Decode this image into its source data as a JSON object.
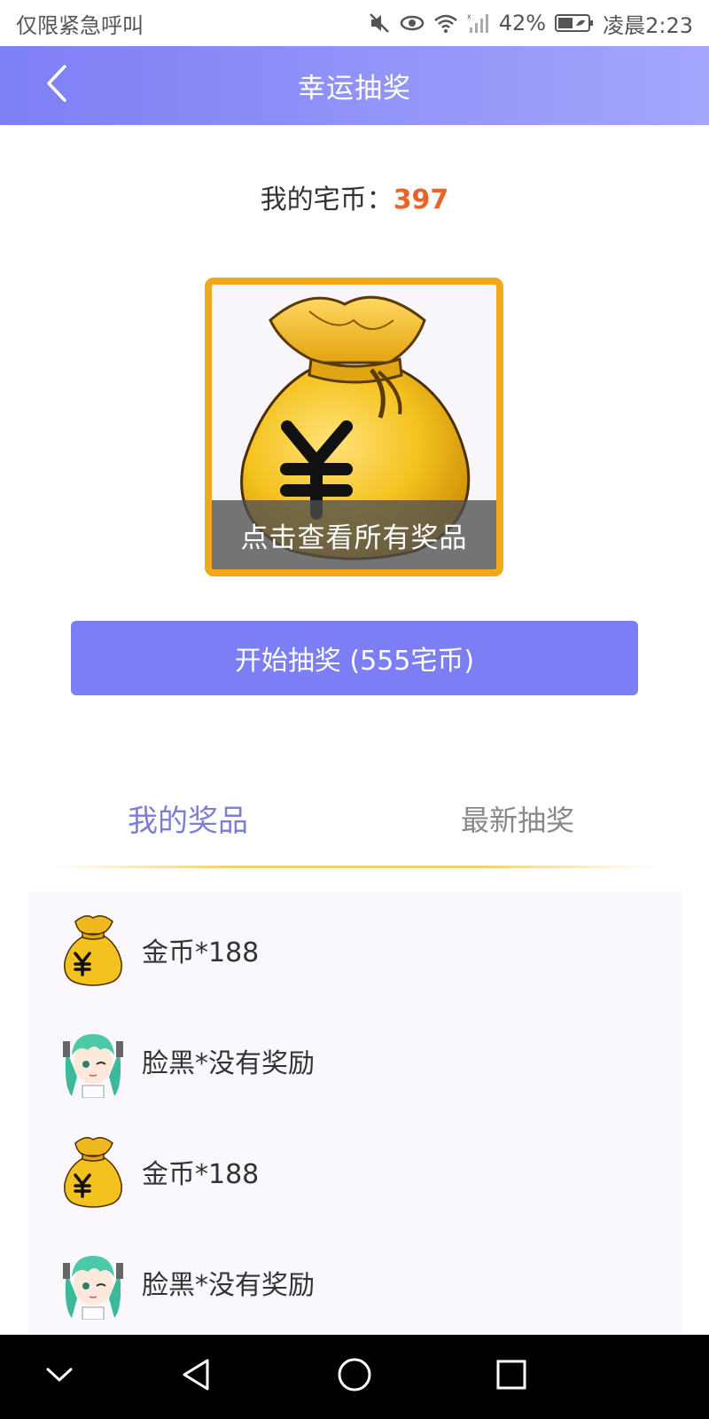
{
  "status_bar": {
    "left_text": "仅限紧急呼叫",
    "battery": "42%",
    "time": "凌晨2:23"
  },
  "header": {
    "title": "幸运抽奖",
    "back_icon": "chevron-left-icon"
  },
  "coins": {
    "label": "我的宅币：",
    "value": "397",
    "value_color": "#e9642b"
  },
  "prize_card": {
    "overlay_text": "点击查看所有奖品",
    "border_color": "#f2a81d"
  },
  "start_button": {
    "label": "开始抽奖 (555宅币)",
    "color": "#7c7ef5"
  },
  "tabs": [
    {
      "label": "我的奖品",
      "active": true
    },
    {
      "label": "最新抽奖",
      "active": false
    }
  ],
  "prize_list": [
    {
      "label": "金币*188",
      "icon": "money-bag-icon"
    },
    {
      "label": "脸黑*没有奖励",
      "icon": "anime-avatar-icon"
    },
    {
      "label": "金币*188",
      "icon": "money-bag-icon"
    },
    {
      "label": "脸黑*没有奖励",
      "icon": "anime-avatar-icon"
    }
  ],
  "nav_bar": {
    "icons": [
      "chevron-down-icon",
      "back-triangle-icon",
      "home-circle-icon",
      "recents-square-icon"
    ]
  }
}
